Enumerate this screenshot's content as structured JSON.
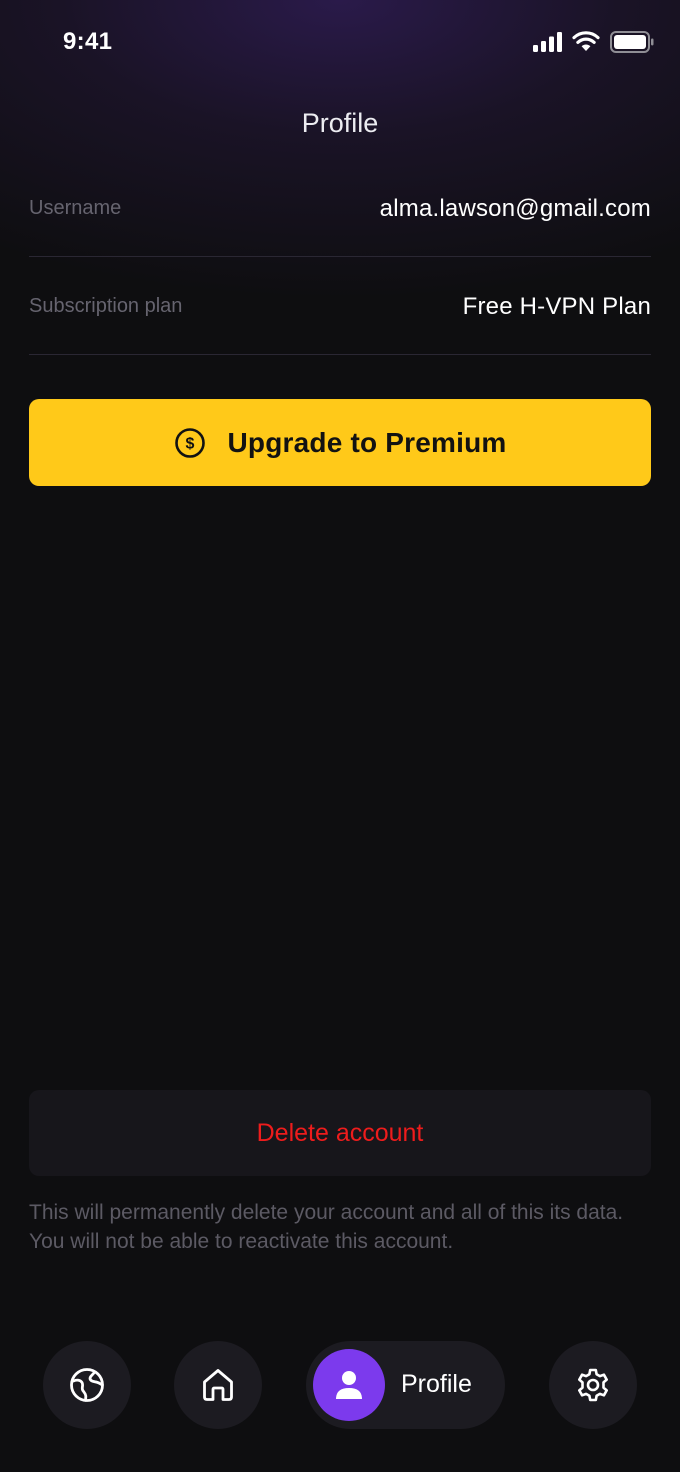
{
  "status_bar": {
    "time": "9:41",
    "icons": [
      "signal-icon",
      "wifi-icon",
      "battery-icon"
    ]
  },
  "header": {
    "title": "Profile"
  },
  "profile": {
    "rows": [
      {
        "label": "Username",
        "value": "alma.lawson@gmail.com"
      },
      {
        "label": "Subscription plan",
        "value": "Free H-VPN Plan"
      }
    ]
  },
  "upgrade": {
    "label": "Upgrade to Premium",
    "icon": "dollar-icon",
    "color": "#ffc919"
  },
  "delete": {
    "label": "Delete account",
    "color": "#ee1c1c",
    "note": "This will permanently delete your account and all of this its data. You will not be able to reactivate this account."
  },
  "bottom_nav": {
    "items": [
      {
        "icon": "globe-icon",
        "label": ""
      },
      {
        "icon": "home-icon",
        "label": ""
      },
      {
        "icon": "user-icon",
        "label": "Profile",
        "active": true
      },
      {
        "icon": "gear-icon",
        "label": ""
      }
    ],
    "accent": "#7c3aed"
  }
}
